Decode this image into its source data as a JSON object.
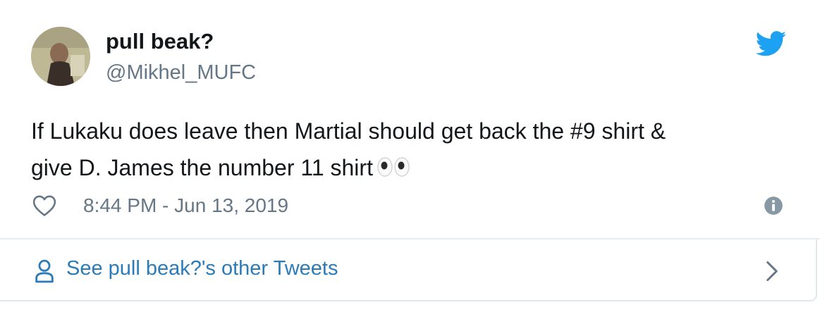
{
  "tweet": {
    "author": {
      "display_name": "pull beak?",
      "handle": "@Mikhel_MUFC",
      "avatar_icon": "avatar-photo"
    },
    "text_line1": "If Lukaku does leave then Martial should get back the #9 shirt &",
    "text_line2": "give D. James the number 11 shirt",
    "emoji": "eyes",
    "timestamp": "8:44 PM - Jun 13, 2019",
    "icons": {
      "like": "heart-icon",
      "info": "info-icon",
      "brand": "twitter-bird-icon"
    }
  },
  "footer": {
    "link_label": "See pull beak?'s other Tweets",
    "icon": "person-icon",
    "chevron": "chevron-right-icon"
  },
  "colors": {
    "text_primary": "#14171a",
    "text_secondary": "#657786",
    "link": "#2b7bb9",
    "twitter_blue": "#1da1f2",
    "divider": "#e6ecf0"
  }
}
